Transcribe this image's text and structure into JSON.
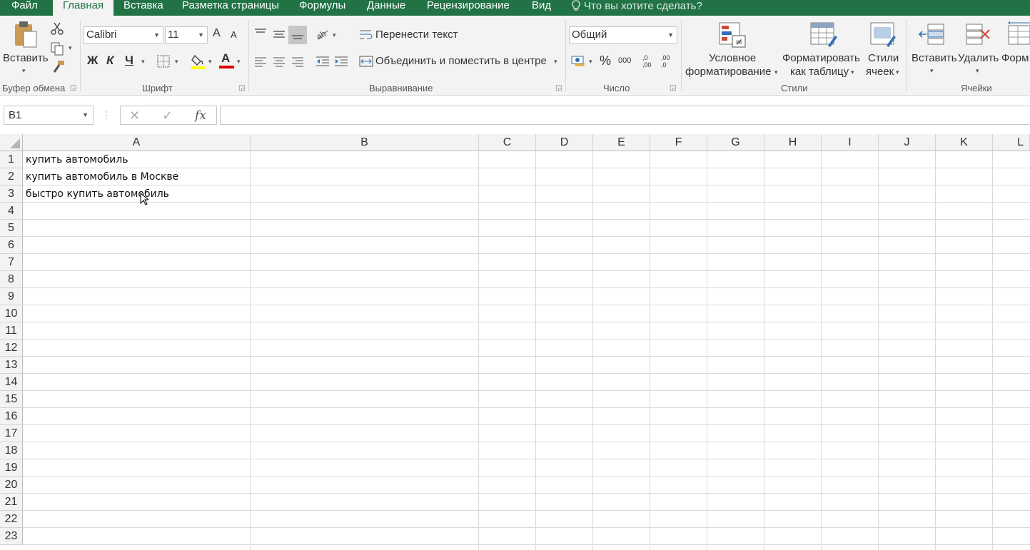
{
  "menu": {
    "tabs": [
      "Файл",
      "Главная",
      "Вставка",
      "Разметка страницы",
      "Формулы",
      "Данные",
      "Рецензирование",
      "Вид"
    ],
    "active": "Главная",
    "tell_me": "Что вы хотите сделать?"
  },
  "ribbon": {
    "clipboard": {
      "paste": "Вставить",
      "label": "Буфер обмена"
    },
    "font": {
      "name": "Calibri",
      "size": "11",
      "bold": "Ж",
      "italic": "К",
      "underline": "Ч",
      "grow": "A",
      "shrink": "A",
      "label": "Шрифт"
    },
    "alignment": {
      "wrap": "Перенести текст",
      "merge": "Объединить и поместить в центре",
      "label": "Выравнивание"
    },
    "number": {
      "format": "Общий",
      "percent": "%",
      "thousands": "000",
      "inc_dec": ",0 ,00",
      "dec_dec": ",00 ,0",
      "label": "Число"
    },
    "styles": {
      "conditional": [
        "Условное",
        "форматирование"
      ],
      "as_table": [
        "Форматировать",
        "как таблицу"
      ],
      "cell_styles": [
        "Стили",
        "ячеек"
      ],
      "label": "Стили"
    },
    "cells": {
      "insert": "Вставить",
      "delete": "Удалить",
      "format": "Форм",
      "label": "Ячейки"
    }
  },
  "formula_bar": {
    "name_box": "B1",
    "fx": "fx",
    "value": ""
  },
  "sheet": {
    "columns": [
      "A",
      "B",
      "C",
      "D",
      "E",
      "F",
      "G",
      "H",
      "I",
      "J",
      "K",
      "L"
    ],
    "rows": [
      "1",
      "2",
      "3",
      "4",
      "5",
      "6",
      "7",
      "8",
      "9",
      "10",
      "11",
      "12",
      "13",
      "14",
      "15",
      "16",
      "17",
      "18",
      "19",
      "20",
      "21",
      "22",
      "23"
    ],
    "cells": [
      {
        "ref": "A1",
        "value": "купить автомобиль"
      },
      {
        "ref": "A2",
        "value": "купить автомобиль в Москве"
      },
      {
        "ref": "A3",
        "value": "быстро купить автомобиль"
      }
    ]
  },
  "colors": {
    "accent": "#217346",
    "highlight": "#ffff00",
    "font_color": "#e00000"
  }
}
